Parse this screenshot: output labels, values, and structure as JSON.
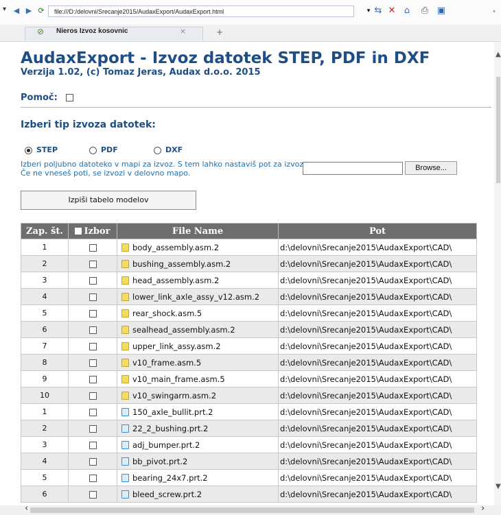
{
  "browser": {
    "address": "file:///D:/delovni/Srecanje2015/AudaxExport/AudaxExport.html",
    "tab_title": "Nieros Izvoz kosovnic",
    "tab_close": "×",
    "tab_new": "+",
    "gutter_mark": "ˣ"
  },
  "page": {
    "title": "AudaxExport - Izvoz datotek STEP, PDF in DXF",
    "subtitle": "Verzija 1.02, (c) Tomaz Jeras, Audax d.o.o. 2015",
    "help_label": "Pomoč:",
    "help_checked": false,
    "export_title": "Izberi tip izvoza datotek:",
    "radios": [
      {
        "label": "STEP",
        "selected": true
      },
      {
        "label": "PDF",
        "selected": false
      },
      {
        "label": "DXF",
        "selected": false
      }
    ],
    "description": "Izberi poljubno datoteko v mapi za izvoz. S tem lahko nastaviš pot za izvoz. Če ne vneseš poti, se izvozi v delovno mapo.",
    "browse_label": "Browse...",
    "print_button": "Izpiši tabelo modelov"
  },
  "table": {
    "headers": [
      "Zap. št.",
      "Izbor",
      "File Name",
      "Pot"
    ],
    "rows": [
      {
        "num": "1",
        "name": "body_assembly.asm.2",
        "type": "asm",
        "pot": "d:\\delovni\\Srecanje2015\\AudaxExport\\CAD\\"
      },
      {
        "num": "2",
        "name": "bushing_assembly.asm.2",
        "type": "asm",
        "pot": "d:\\delovni\\Srecanje2015\\AudaxExport\\CAD\\"
      },
      {
        "num": "3",
        "name": "head_assembly.asm.2",
        "type": "asm",
        "pot": "d:\\delovni\\Srecanje2015\\AudaxExport\\CAD\\"
      },
      {
        "num": "4",
        "name": "lower_link_axle_assy_v12.asm.2",
        "type": "asm",
        "pot": "d:\\delovni\\Srecanje2015\\AudaxExport\\CAD\\"
      },
      {
        "num": "5",
        "name": "rear_shock.asm.5",
        "type": "asm",
        "pot": "d:\\delovni\\Srecanje2015\\AudaxExport\\CAD\\"
      },
      {
        "num": "6",
        "name": "sealhead_assembly.asm.2",
        "type": "asm",
        "pot": "d:\\delovni\\Srecanje2015\\AudaxExport\\CAD\\"
      },
      {
        "num": "7",
        "name": "upper_link_assy.asm.2",
        "type": "asm",
        "pot": "d:\\delovni\\Srecanje2015\\AudaxExport\\CAD\\"
      },
      {
        "num": "8",
        "name": "v10_frame.asm.5",
        "type": "asm",
        "pot": "d:\\delovni\\Srecanje2015\\AudaxExport\\CAD\\"
      },
      {
        "num": "9",
        "name": "v10_main_frame.asm.5",
        "type": "asm",
        "pot": "d:\\delovni\\Srecanje2015\\AudaxExport\\CAD\\"
      },
      {
        "num": "10",
        "name": "v10_swingarm.asm.2",
        "type": "asm",
        "pot": "d:\\delovni\\Srecanje2015\\AudaxExport\\CAD\\"
      },
      {
        "num": "1",
        "name": "150_axle_bullit.prt.2",
        "type": "prt",
        "pot": "d:\\delovni\\Srecanje2015\\AudaxExport\\CAD\\"
      },
      {
        "num": "2",
        "name": "22_2_bushing.prt.2",
        "type": "prt",
        "pot": "d:\\delovni\\Srecanje2015\\AudaxExport\\CAD\\"
      },
      {
        "num": "3",
        "name": "adj_bumper.prt.2",
        "type": "prt",
        "pot": "d:\\delovni\\Srecanje2015\\AudaxExport\\CAD\\"
      },
      {
        "num": "4",
        "name": "bb_pivot.prt.2",
        "type": "prt",
        "pot": "d:\\delovni\\Srecanje2015\\AudaxExport\\CAD\\"
      },
      {
        "num": "5",
        "name": "bearing_24x7.prt.2",
        "type": "prt",
        "pot": "d:\\delovni\\Srecanje2015\\AudaxExport\\CAD\\"
      },
      {
        "num": "6",
        "name": "bleed_screw.prt.2",
        "type": "prt",
        "pot": "d:\\delovni\\Srecanje2015\\AudaxExport\\CAD\\"
      }
    ]
  }
}
